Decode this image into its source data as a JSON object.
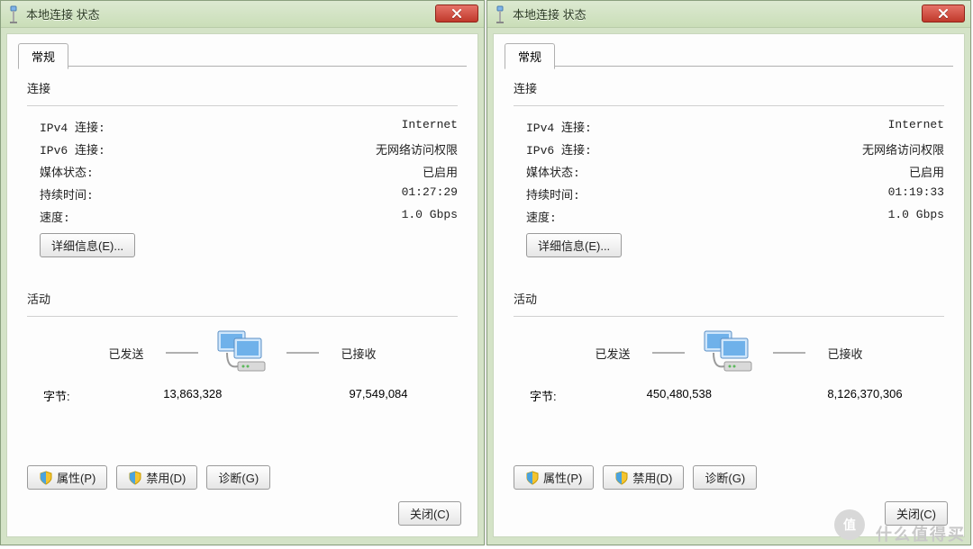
{
  "windows": [
    {
      "title": "本地连接 状态",
      "tab": "常规",
      "connection_header": "连接",
      "ipv4": {
        "label": "IPv4 连接:",
        "value": "Internet"
      },
      "ipv6": {
        "label": "IPv6 连接:",
        "value": "无网络访问权限"
      },
      "media": {
        "label": "媒体状态:",
        "value": "已启用"
      },
      "duration": {
        "label": "持续时间:",
        "value": "01:27:29"
      },
      "speed": {
        "label": "速度:",
        "value": "1.0 Gbps"
      },
      "details_btn": "详细信息(E)...",
      "activity_header": "活动",
      "sent_label": "已发送",
      "recv_label": "已接收",
      "bytes_label": "字节:",
      "bytes_sent": "13,863,328",
      "bytes_recv": "97,549,084",
      "props_btn": "属性(P)",
      "disable_btn": "禁用(D)",
      "diag_btn": "诊断(G)",
      "close_btn": "关闭(C)"
    },
    {
      "title": "本地连接 状态",
      "tab": "常规",
      "connection_header": "连接",
      "ipv4": {
        "label": "IPv4 连接:",
        "value": "Internet"
      },
      "ipv6": {
        "label": "IPv6 连接:",
        "value": "无网络访问权限"
      },
      "media": {
        "label": "媒体状态:",
        "value": "已启用"
      },
      "duration": {
        "label": "持续时间:",
        "value": "01:19:33"
      },
      "speed": {
        "label": "速度:",
        "value": "1.0 Gbps"
      },
      "details_btn": "详细信息(E)...",
      "activity_header": "活动",
      "sent_label": "已发送",
      "recv_label": "已接收",
      "bytes_label": "字节:",
      "bytes_sent": "450,480,538",
      "bytes_recv": "8,126,370,306",
      "props_btn": "属性(P)",
      "disable_btn": "禁用(D)",
      "diag_btn": "诊断(G)",
      "close_btn": "关闭(C)"
    }
  ],
  "watermark": {
    "badge": "值",
    "text": "什么值得买"
  }
}
